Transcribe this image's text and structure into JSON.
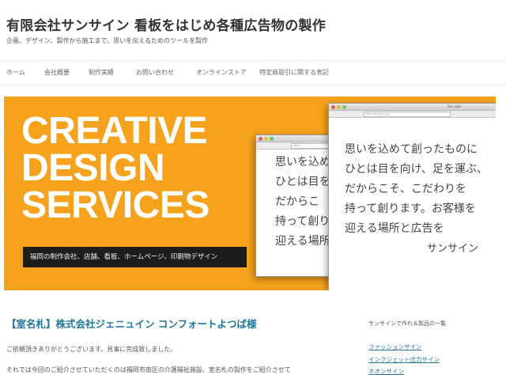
{
  "header": {
    "site_title": "有限会社サンサイン 看板をはじめ各種広告物の製作",
    "tagline": "企画、デザイン、製作から施工まで。思いを伝えるためのツールを製作"
  },
  "nav": {
    "items": [
      {
        "label": "ホーム"
      },
      {
        "label": "会社概要"
      },
      {
        "label": "制作実績"
      },
      {
        "label": "お問い合わせ"
      },
      {
        "label": "オンラインストア"
      },
      {
        "label": "特定商取引に関する表記"
      }
    ]
  },
  "hero": {
    "title_lines": [
      "CREATIVE",
      "DESIGN",
      "SERVICES"
    ],
    "subtitle": "福岡の制作会社、店舗、看板、ホームページ、印刷物デザイン",
    "back_window": {
      "url": "http://...",
      "lines": [
        "思いを込め",
        "ひとは目を",
        "だからこ",
        "持って創り",
        "迎える場所"
      ]
    },
    "front_window": {
      "tab": "Sun sign",
      "url": "http://sunsign.co.jp/",
      "lines": [
        "思いを込めて創ったものに",
        "ひとは目を向け、足を運ぶ、",
        "だからこそ、こだわりを",
        "持って創ります。お客様を",
        "迎える場所と広告を"
      ],
      "signature": "サンサイン"
    },
    "colors": {
      "background": "#f6a21d",
      "subtitle_bg": "#1d1d1d"
    }
  },
  "post": {
    "title": "【室名札】株式会社ジェニュイン コンフォートよつば様",
    "line1": "ご依頼頂きありがとうございます。見事に完成致しました。",
    "line2": "それでは今回のご紹介させていただくのは福岡市南区の介護福祉施設、室名札の製作をご紹介させて"
  },
  "sidebar": {
    "widget_title": "サンサインで作れる製品の一覧",
    "links": [
      {
        "label": "ファッションサイン"
      },
      {
        "label": "インクジェット出力サイン"
      },
      {
        "label": "ネオンサイン"
      }
    ]
  },
  "theme": {
    "link_color": "#21759b",
    "accent": "#f6a21d"
  }
}
